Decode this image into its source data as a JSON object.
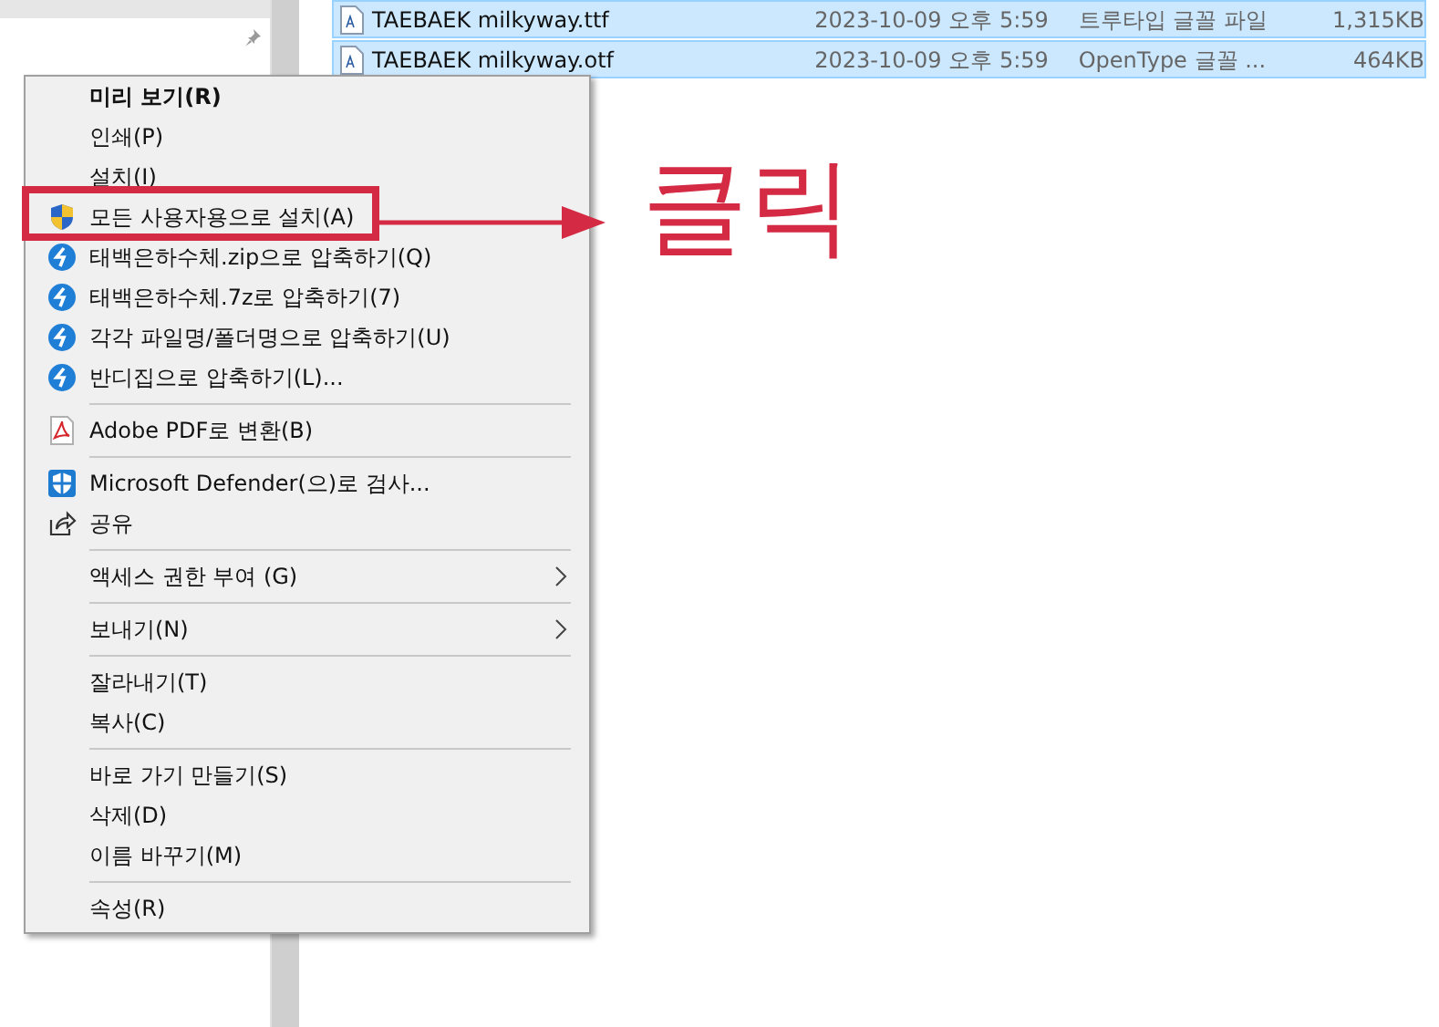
{
  "files": [
    {
      "name": "TAEBAEK milkyway.ttf",
      "date": "2023-10-09 오후 5:59",
      "type": "트루타입 글꼴 파일",
      "size": "1,315KB",
      "selected": true
    },
    {
      "name": "TAEBAEK milkyway.otf",
      "date": "2023-10-09 오후 5:59",
      "type": "OpenType 글꼴 ...",
      "size": "464KB",
      "selected": true
    }
  ],
  "context_menu": {
    "groups": [
      [
        {
          "label": "미리 보기(R)",
          "kind": "plain",
          "default": true,
          "submenu": false,
          "marked": false
        },
        {
          "label": "인쇄(P)",
          "kind": "plain",
          "default": false,
          "submenu": false,
          "marked": false
        },
        {
          "label": "설치(I)",
          "kind": "plain",
          "default": false,
          "submenu": false,
          "marked": false
        },
        {
          "label": "모든 사용자용으로 설치(A)",
          "kind": "shield",
          "default": false,
          "submenu": false,
          "marked": true
        },
        {
          "label": "태백은하수체.zip으로 압축하기(Q)",
          "kind": "archive",
          "default": false,
          "submenu": false,
          "marked": false
        },
        {
          "label": "태백은하수체.7z로 압축하기(7)",
          "kind": "archive",
          "default": false,
          "submenu": false,
          "marked": false
        },
        {
          "label": "각각 파일명/폴더명으로 압축하기(U)",
          "kind": "archive",
          "default": false,
          "submenu": false,
          "marked": false
        },
        {
          "label": "반디집으로 압축하기(L)...",
          "kind": "archive",
          "default": false,
          "submenu": false,
          "marked": false
        }
      ],
      [
        {
          "label": "Adobe PDF로 변환(B)",
          "kind": "pdf",
          "default": false,
          "submenu": false,
          "marked": false
        }
      ],
      [
        {
          "label": "Microsoft Defender(으)로 검사...",
          "kind": "defender",
          "default": false,
          "submenu": false,
          "marked": false
        },
        {
          "label": "공유",
          "kind": "share",
          "default": false,
          "submenu": false,
          "marked": false
        }
      ],
      [
        {
          "label": "액세스 권한 부여 (G)",
          "kind": "plain",
          "default": false,
          "submenu": true,
          "marked": false
        }
      ],
      [
        {
          "label": "보내기(N)",
          "kind": "plain",
          "default": false,
          "submenu": true,
          "marked": false
        }
      ],
      [
        {
          "label": "잘라내기(T)",
          "kind": "plain",
          "default": false,
          "submenu": false,
          "marked": false
        },
        {
          "label": "복사(C)",
          "kind": "plain",
          "default": false,
          "submenu": false,
          "marked": false
        }
      ],
      [
        {
          "label": "바로 가기 만들기(S)",
          "kind": "plain",
          "default": false,
          "submenu": false,
          "marked": false
        },
        {
          "label": "삭제(D)",
          "kind": "plain",
          "default": false,
          "submenu": false,
          "marked": false
        },
        {
          "label": "이름 바꾸기(M)",
          "kind": "plain",
          "default": false,
          "submenu": false,
          "marked": false
        }
      ],
      [
        {
          "label": "속성(R)",
          "kind": "plain",
          "default": false,
          "submenu": false,
          "marked": false
        }
      ]
    ]
  },
  "annotation": {
    "label": "클릭"
  }
}
